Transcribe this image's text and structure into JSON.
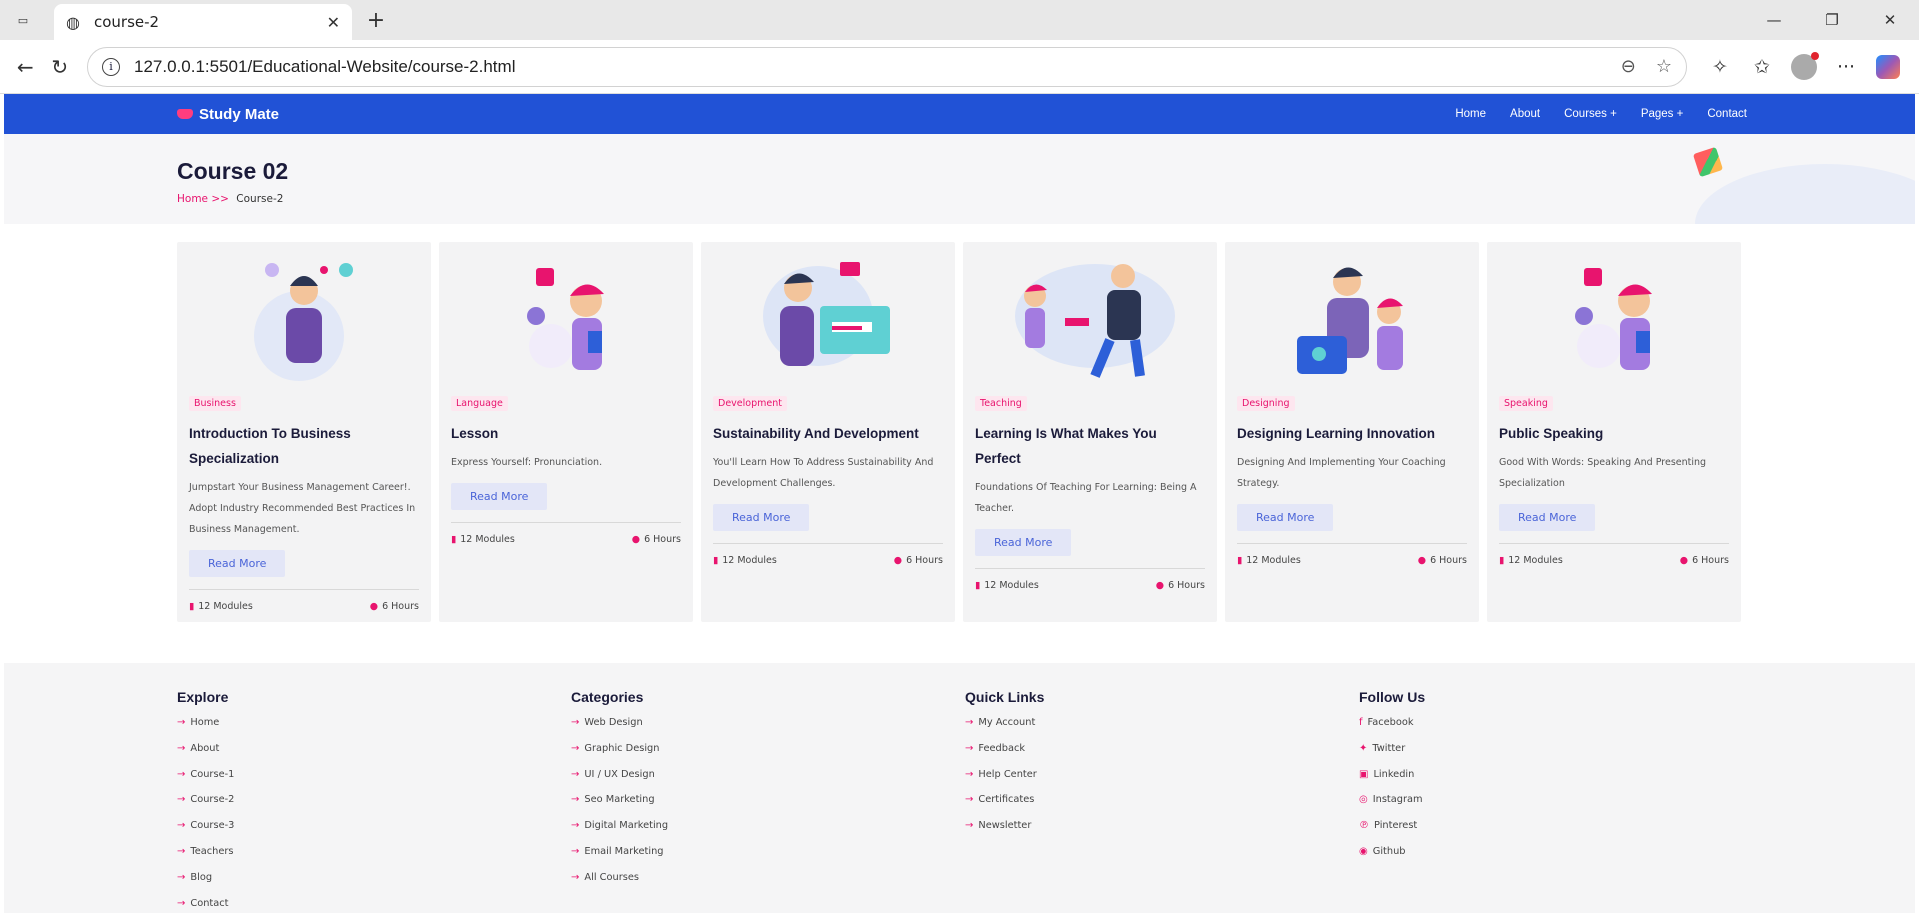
{
  "browser": {
    "tab_title": "course-2",
    "url": "127.0.0.1:5501/Educational-Website/course-2.html"
  },
  "site": {
    "brand": "Study Mate",
    "menu": [
      "Home",
      "About",
      "Courses +",
      "Pages +",
      "Contact"
    ],
    "page_title": "Course 02",
    "breadcrumb_home": "Home >>",
    "breadcrumb_current": "Course-2"
  },
  "courses": [
    {
      "tag": "Business",
      "title": "Introduction To Business Specialization",
      "desc": "Jumpstart Your Business Management Career!. Adopt Industry Recommended Best Practices In Business Management.",
      "button": "Read More",
      "modules": "12 Modules",
      "hours": "6 Hours"
    },
    {
      "tag": "Language",
      "title": "Lesson",
      "desc": "Express Yourself: Pronunciation.",
      "button": "Read More",
      "modules": "12 Modules",
      "hours": "6 Hours"
    },
    {
      "tag": "Development",
      "title": "Sustainability And Development",
      "desc": "You'll Learn How To Address Sustainability And Development Challenges.",
      "button": "Read More",
      "modules": "12 Modules",
      "hours": "6 Hours"
    },
    {
      "tag": "Teaching",
      "title": "Learning Is What Makes You Perfect",
      "desc": "Foundations Of Teaching For Learning: Being A Teacher.",
      "button": "Read More",
      "modules": "12 Modules",
      "hours": "6 Hours"
    },
    {
      "tag": "Designing",
      "title": "Designing Learning Innovation",
      "desc": "Designing And Implementing Your Coaching Strategy.",
      "button": "Read More",
      "modules": "12 Modules",
      "hours": "6 Hours"
    },
    {
      "tag": "Speaking",
      "title": "Public Speaking",
      "desc": "Good With Words: Speaking And Presenting Specialization",
      "button": "Read More",
      "modules": "12 Modules",
      "hours": "6 Hours"
    }
  ],
  "footer": {
    "explore": {
      "title": "Explore",
      "items": [
        "Home",
        "About",
        "Course-1",
        "Course-2",
        "Course-3",
        "Teachers",
        "Blog",
        "Contact"
      ]
    },
    "categories": {
      "title": "Categories",
      "items": [
        "Web Design",
        "Graphic Design",
        "UI / UX Design",
        "Seo Marketing",
        "Digital Marketing",
        "Email Marketing",
        "All Courses"
      ]
    },
    "quick_links": {
      "title": "Quick Links",
      "items": [
        "My Account",
        "Feedback",
        "Help Center",
        "Certificates",
        "Newsletter"
      ]
    },
    "follow": {
      "title": "Follow Us",
      "items": [
        "Facebook",
        "Twitter",
        "Linkedin",
        "Instagram",
        "Pinterest",
        "Github"
      ]
    }
  },
  "colors": {
    "nav": "#2152d6",
    "accent": "#e8146e",
    "button_bg": "#e3e6f7"
  }
}
